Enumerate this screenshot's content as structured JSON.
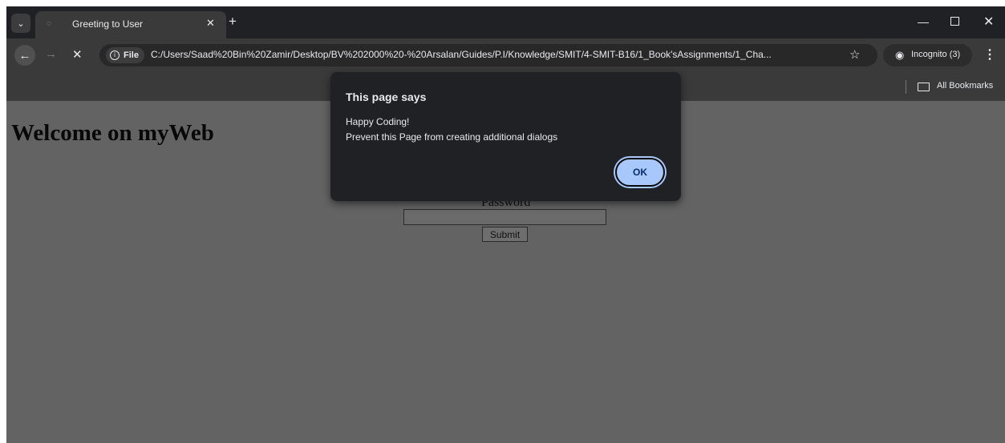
{
  "browser": {
    "tab": {
      "title": "Greeting to User"
    },
    "address": {
      "scheme_label": "File",
      "url": "C:/Users/Saad%20Bin%20Zamir/Desktop/BV%202000%20-%20Arsalan/Guides/P.I/Knowledge/SMIT/4-SMIT-B16/1_Book'sAssignments/1_Cha..."
    },
    "incognito_label": "Incognito (3)",
    "bookmarks": {
      "all_label": "All Bookmarks"
    }
  },
  "page": {
    "heading": "Welcome on myWeb",
    "password_label": "Password",
    "submit_label": "Submit"
  },
  "dialog": {
    "title": "This page says",
    "message": "Happy Coding!",
    "prevent_label": "Prevent this Page from creating additional dialogs",
    "ok_label": "OK"
  },
  "colors": {
    "chrome_bg": "#202124",
    "toolbar_bg": "#3a3a3a",
    "page_dimmed": "#636363",
    "ok_button": "#a8c7fa"
  }
}
